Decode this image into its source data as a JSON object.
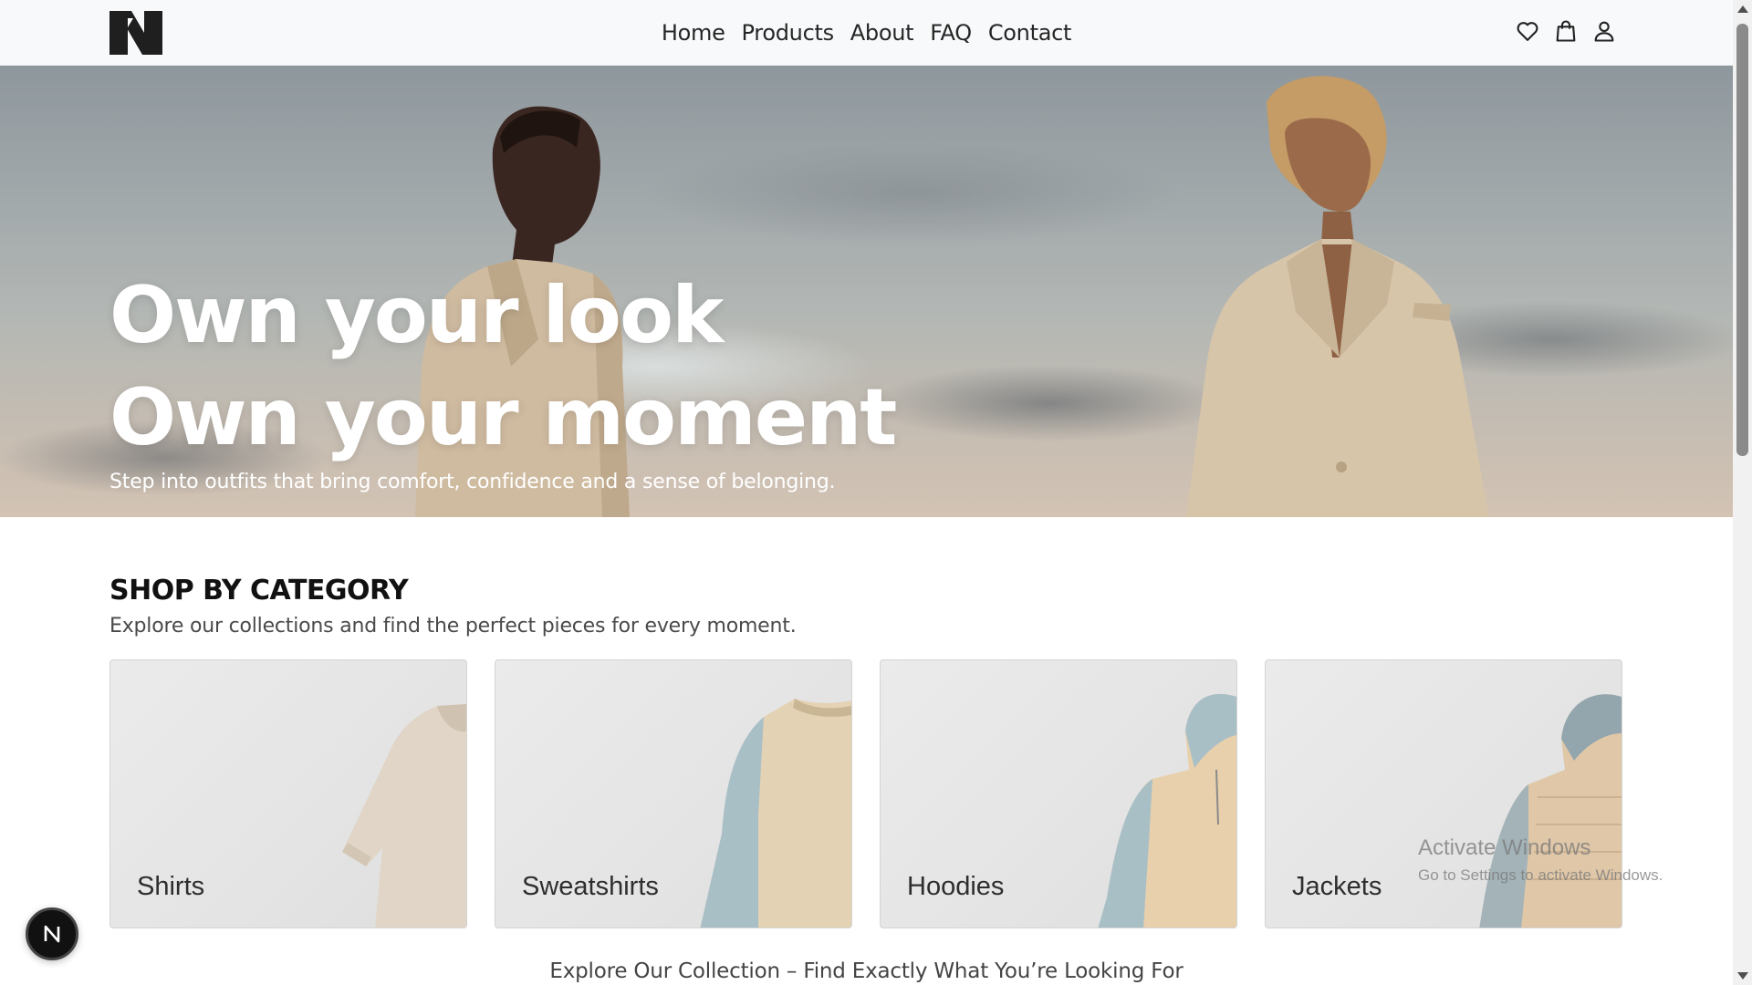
{
  "header": {
    "logo_icon": "brand-n-logo",
    "nav": [
      {
        "label": "Home"
      },
      {
        "label": "Products"
      },
      {
        "label": "About"
      },
      {
        "label": "FAQ"
      },
      {
        "label": "Contact"
      }
    ],
    "icons": [
      "heart-icon",
      "shopping-bag-icon",
      "user-icon"
    ]
  },
  "hero": {
    "line1": "Own your look",
    "line2": "Own your moment",
    "subtitle": "Step into outfits that bring comfort, confidence and a sense of belonging."
  },
  "categories": {
    "title": "SHOP BY CATEGORY",
    "subtitle": "Explore our collections and find the perfect pieces for every moment.",
    "items": [
      {
        "label": "Shirts"
      },
      {
        "label": "Sweatshirts"
      },
      {
        "label": "Hoodies"
      },
      {
        "label": "Jackets"
      }
    ]
  },
  "explore_text": "Explore Our Collection – Find Exactly What You’re Looking For",
  "watermark": {
    "title": "Activate Windows",
    "subtitle": "Go to Settings to activate Windows."
  },
  "fab": {
    "letter": "N"
  },
  "colors": {
    "header_bg": "#f8f9fa",
    "card_bg": "#e6e6e6",
    "coat_beige": "#d9c7ad",
    "sleeve_blue": "#a9bfc6"
  }
}
